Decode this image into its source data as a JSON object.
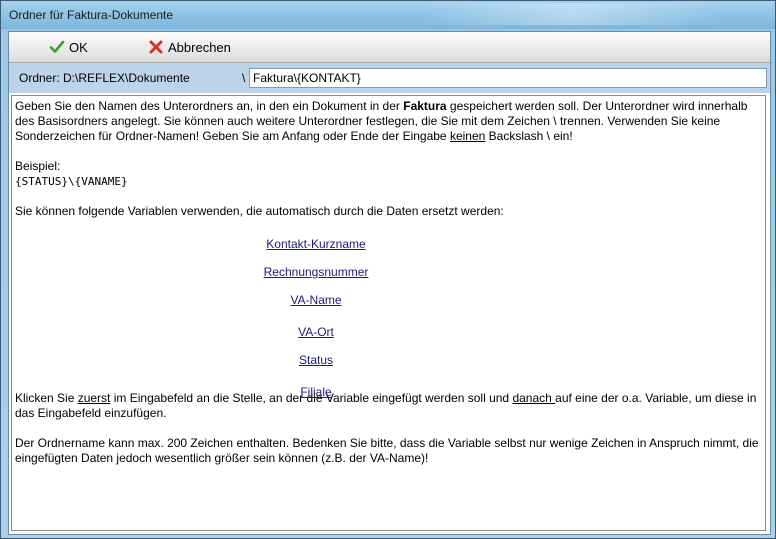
{
  "window": {
    "title": "Ordner für Faktura-Dokumente"
  },
  "toolbar": {
    "ok_label": "OK",
    "cancel_label": "Abbrechen"
  },
  "path": {
    "label": "Ordner:  D:\\REFLEX\\Dokumente",
    "separator": "\\",
    "value": "Faktura\\{KONTAKT}"
  },
  "help": {
    "intro_1": "Geben Sie den Namen des Unterordners an, in den ein Dokument in der ",
    "intro_bold": "Faktura",
    "intro_2": " gespeichert werden soll. Der Unterordner wird innerhalb des Basisordners angelegt. Sie können auch weitere Unterordner festlegen, die Sie mit dem Zeichen \\ trennen. Verwenden Sie keine Sonderzeichen für Ordner-Namen! Geben Sie am Anfang oder Ende der Eingabe ",
    "intro_underline": "keinen",
    "intro_3": " Backslash \\ ein!",
    "example_label": "Beispiel:",
    "example_code": "{STATUS}\\{VANAME}",
    "variables_intro": "Sie können folgende Variablen verwenden, die automatisch durch die Daten ersetzt werden:",
    "variables": [
      "Kontakt-Kurzname",
      "Rechnungsnummer",
      "VA-Name",
      "VA-Ort",
      "Status",
      "Filiale"
    ],
    "click_1": "Klicken Sie ",
    "click_u1": "zuerst",
    "click_2": " im Eingabefeld an die Stelle, an der die Variable eingefügt werden soll und ",
    "click_u2": "danach ",
    "click_3": "auf eine der o.a. Variable, um diese in das Eingabefeld einzufügen.",
    "limit": "Der Ordnername kann max. 200 Zeichen enthalten. Bedenken Sie bitte, dass die Variable selbst nur wenige Zeichen in Anspruch nimmt, die eingefügten Daten jedoch wesentlich größer sein können (z.B. der VA-Name)!"
  }
}
